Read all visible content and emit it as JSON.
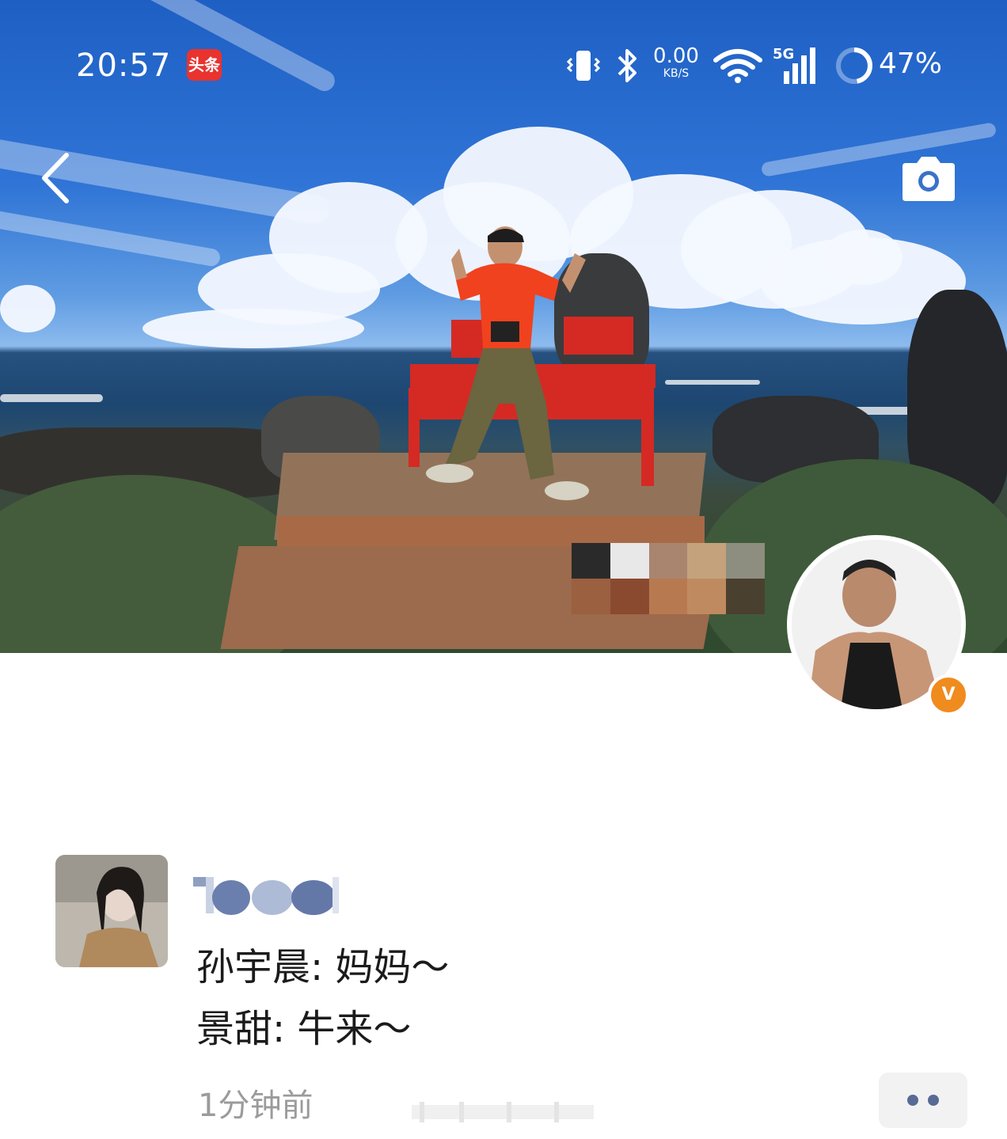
{
  "status_bar": {
    "time": "20:57",
    "app_badge": "头条",
    "net_speed_value": "0.00",
    "net_speed_unit": "KB/S",
    "network_type": "5G",
    "battery_percent": "47%",
    "battery_level": 0.47
  },
  "header": {
    "back_icon": "chevron-left-icon",
    "camera_icon": "camera-icon"
  },
  "profile": {
    "verified_mark": "V",
    "badge_color": "#f08b1e"
  },
  "post": {
    "comments": [
      "孙宇晨: 妈妈～",
      "景甜: 牛来～"
    ],
    "timestamp": "1分钟前",
    "more_icon": "more-dots-icon",
    "link_color": "#576b95"
  }
}
